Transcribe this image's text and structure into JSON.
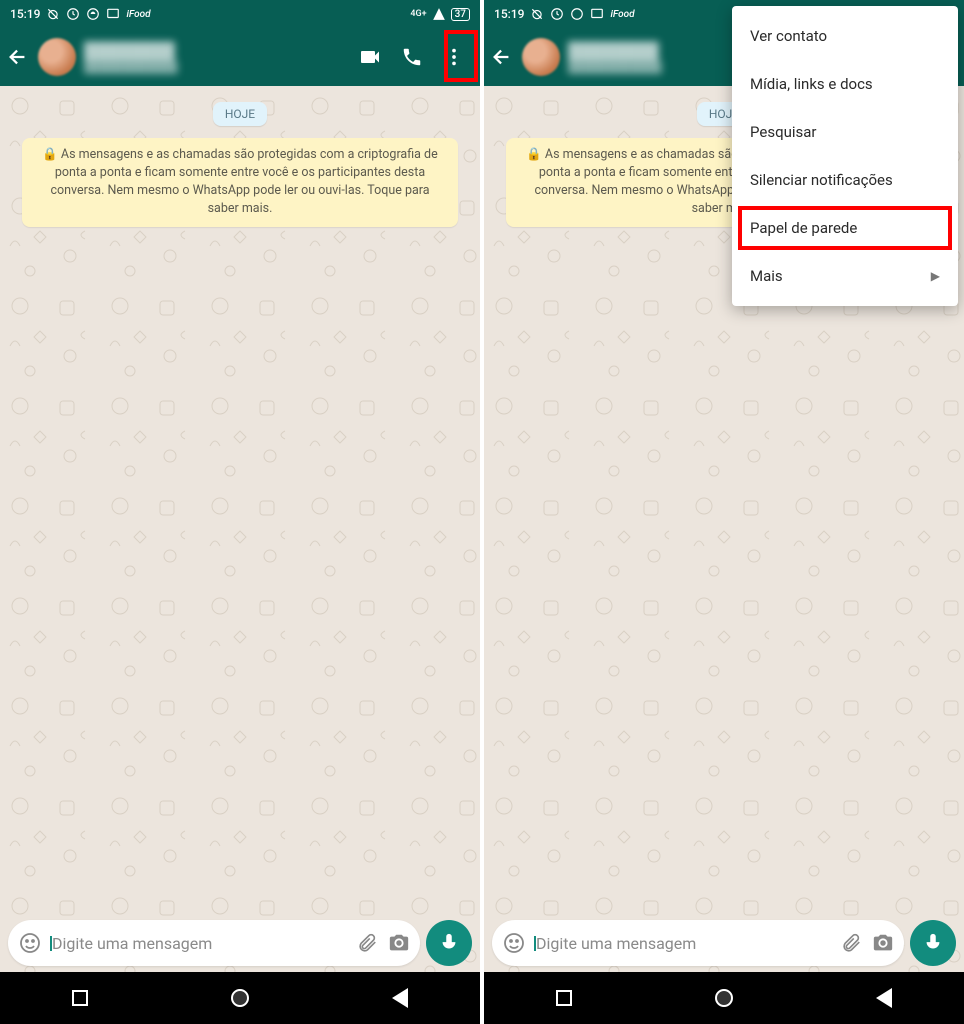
{
  "statusbar": {
    "time": "15:19",
    "network": "4G+",
    "battery": "37"
  },
  "chat": {
    "date_label": "HOJE",
    "encryption_notice": "🔒 As mensagens e as chamadas são protegidas com a criptografia de ponta a ponta e ficam somente entre você e os participantes desta conversa. Nem mesmo o WhatsApp pode ler ou ouvi-las. Toque para saber mais."
  },
  "input": {
    "placeholder": "Digite uma mensagem"
  },
  "menu": {
    "items": [
      "Ver contato",
      "Mídia, links e docs",
      "Pesquisar",
      "Silenciar notificações",
      "Papel de parede",
      "Mais"
    ]
  }
}
